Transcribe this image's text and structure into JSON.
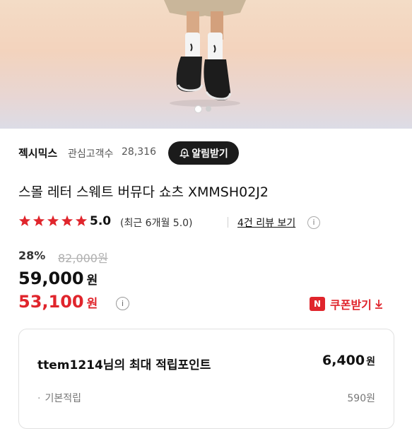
{
  "brand": {
    "name": "젝시믹스",
    "follower_label": "관심고객수",
    "follower_count": "28,316",
    "alarm_label": "알림받기"
  },
  "product": {
    "title": "스몰 레터 스웨트 버뮤다 쇼츠 XMMSH02J2"
  },
  "rating": {
    "stars": 5,
    "value": "5.0",
    "note": "(최근 6개월 5.0)",
    "review_link": "4건 리뷰 보기",
    "star_color": "#e0252c"
  },
  "pricing": {
    "discount_rate": "28%",
    "original_price": "82,000원",
    "sale_price": "59,000",
    "coupon_price": "53,100",
    "currency": "원",
    "coupon_badge": "N",
    "coupon_label": "쿠폰받기",
    "accent_color": "#e0252c"
  },
  "points": {
    "title": "ttem1214님의 최대 적립포인트",
    "value": "6,400",
    "currency": "원",
    "basic_label": "기본적립",
    "basic_value": "590원"
  },
  "carousel": {
    "total": 2,
    "active": 1
  }
}
